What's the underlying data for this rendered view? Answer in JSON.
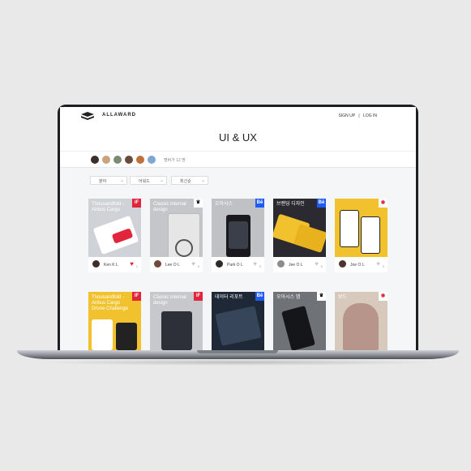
{
  "header": {
    "brand": "ALLAWARD",
    "sign_up": "SIGN UP",
    "separator": "|",
    "log_in": "LOG IN"
  },
  "page": {
    "title": "UI & UX",
    "members": "멤버가 12 명"
  },
  "filters": [
    {
      "label": "분야",
      "icon": "chevron-down-icon"
    },
    {
      "label": "어워드",
      "icon": "chevron-down-icon"
    },
    {
      "label": "최신순",
      "icon": "chevron-down-icon"
    }
  ],
  "colors": {
    "accent_red": "#e0253c",
    "behance_blue": "#1f5cf5",
    "yellow": "#f2c22e"
  },
  "cards": [
    {
      "title": "Thousandfold - Airbus Cargo",
      "badge": "iF",
      "user": "Ken K L",
      "liked": true,
      "count": "1"
    },
    {
      "title": "Classic internal design",
      "badge": "♛",
      "user": "Lee O L",
      "liked": false,
      "count": "0"
    },
    {
      "title": "오아시스",
      "badge": "Bē",
      "user": "Park O L",
      "liked": false,
      "count": "0"
    },
    {
      "title": "브랜딩 디자인",
      "badge": "Bē",
      "user": "Jee O L",
      "liked": false,
      "count": "0"
    },
    {
      "title": "",
      "badge": "◉",
      "user": "Joe O L",
      "liked": false,
      "count": "0"
    },
    {
      "title": "Thousandfold - Airbus Cargo Drone Challenge",
      "badge": "iF",
      "user": "",
      "liked": false,
      "count": ""
    },
    {
      "title": "Classic internal design",
      "badge": "iF",
      "user": "",
      "liked": false,
      "count": ""
    },
    {
      "title": "데이터 리포트",
      "badge": "Bē",
      "user": "",
      "liked": false,
      "count": ""
    },
    {
      "title": "오아시스 앱",
      "badge": "♛",
      "user": "",
      "liked": false,
      "count": ""
    },
    {
      "title": "보드",
      "badge": "◉",
      "user": "",
      "liked": false,
      "count": ""
    }
  ]
}
